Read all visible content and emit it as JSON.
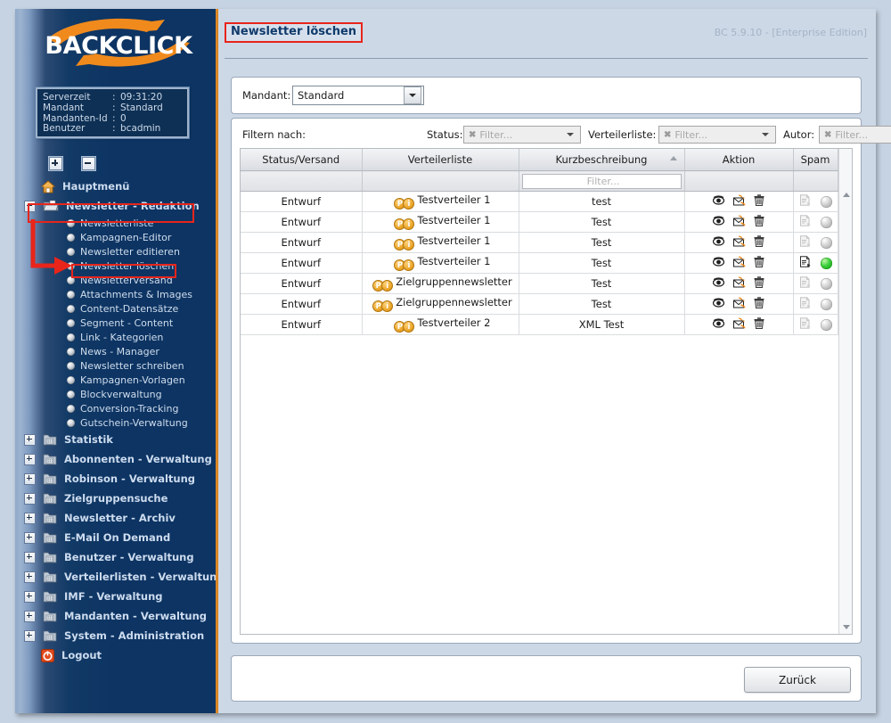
{
  "brand": {
    "logo_text": "BACKCLICK",
    "logo_accent": "#f08a1c"
  },
  "server_info": {
    "rows": [
      {
        "key": "Serverzeit",
        "sep": ":",
        "value": "09:31:20"
      },
      {
        "key": "Mandant",
        "sep": ":",
        "value": "Standard"
      },
      {
        "key": "Mandanten-Id",
        "sep": ":",
        "value": "0"
      },
      {
        "key": "Benutzer",
        "sep": ":",
        "value": "bcadmin"
      }
    ]
  },
  "tree_controls": {
    "expand_all": "expand-all-button",
    "collapse_all": "collapse-all-button"
  },
  "sidebar": {
    "home": {
      "label": "Hauptmenü",
      "icon": "home-icon"
    },
    "sections": [
      {
        "label": "Newsletter - Redaktion",
        "icon": "folder-open-icon",
        "expanded": true,
        "highlighted": true,
        "children": [
          {
            "label": "Newsletterliste"
          },
          {
            "label": "Kampagnen-Editor"
          },
          {
            "label": "Newsletter editieren"
          },
          {
            "label": "Newsletter löschen",
            "highlighted": true
          },
          {
            "label": "Newsletterversand"
          },
          {
            "label": "Attachments & Images"
          },
          {
            "label": "Content-Datensätze"
          },
          {
            "label": "Segment - Content"
          },
          {
            "label": "Link - Kategorien"
          },
          {
            "label": "News - Manager"
          },
          {
            "label": "Newsletter schreiben"
          },
          {
            "label": "Kampagnen-Vorlagen"
          },
          {
            "label": "Blockverwaltung"
          },
          {
            "label": "Conversion-Tracking"
          },
          {
            "label": "Gutschein-Verwaltung"
          }
        ]
      },
      {
        "label": "Statistik",
        "icon": "folder-icon",
        "expanded": false,
        "children": []
      },
      {
        "label": "Abonnenten - Verwaltung",
        "icon": "folder-icon",
        "expanded": false,
        "children": []
      },
      {
        "label": "Robinson - Verwaltung",
        "icon": "folder-icon",
        "expanded": false,
        "children": []
      },
      {
        "label": "Zielgruppensuche",
        "icon": "folder-icon",
        "expanded": false,
        "children": []
      },
      {
        "label": "Newsletter - Archiv",
        "icon": "folder-icon",
        "expanded": false,
        "children": []
      },
      {
        "label": "E-Mail On Demand",
        "icon": "folder-icon",
        "expanded": false,
        "children": []
      },
      {
        "label": "Benutzer - Verwaltung",
        "icon": "folder-icon",
        "expanded": false,
        "children": []
      },
      {
        "label": "Verteilerlisten - Verwaltung",
        "icon": "folder-icon",
        "expanded": false,
        "children": []
      },
      {
        "label": "IMF - Verwaltung",
        "icon": "folder-icon",
        "expanded": false,
        "children": []
      },
      {
        "label": "Mandanten - Verwaltung",
        "icon": "folder-icon",
        "expanded": false,
        "children": []
      },
      {
        "label": "System - Administration",
        "icon": "folder-icon",
        "expanded": false,
        "children": []
      }
    ],
    "logout": {
      "label": "Logout",
      "icon": "power-icon"
    }
  },
  "header": {
    "title": "Newsletter löschen",
    "version": "BC 5.9.10 - [Enterprise Edition]"
  },
  "mandant": {
    "label": "Mandant:",
    "selected": "Standard"
  },
  "filters": {
    "label": "Filtern nach:",
    "fields": [
      {
        "label": "Status:",
        "placeholder": "Filter...",
        "value": ""
      },
      {
        "label": "Verteilerliste:",
        "placeholder": "Filter...",
        "value": ""
      },
      {
        "label": "Autor:",
        "placeholder": "Filter...",
        "value": ""
      }
    ]
  },
  "table": {
    "columns": [
      {
        "label": "Status/Versand",
        "sorted": false
      },
      {
        "label": "Verteilerliste",
        "sorted": false
      },
      {
        "label": "Kurzbeschreibung",
        "sorted": true,
        "sort_dir": "asc"
      },
      {
        "label": "Aktion",
        "sorted": false
      },
      {
        "label": "Spam",
        "sorted": false
      }
    ],
    "column_filter_placeholder": "Filter...",
    "row_badges": [
      "P",
      "i"
    ],
    "action_icons": [
      "preview-eye-icon",
      "send-test-mail-icon",
      "delete-trash-icon"
    ],
    "spam_icons": [
      "spam-report-icon",
      "spam-status-lamp-icon"
    ],
    "rows": [
      {
        "status": "Entwurf",
        "verteilerliste": "Testverteiler 1",
        "kurzbeschreibung": "test",
        "spam_active": false
      },
      {
        "status": "Entwurf",
        "verteilerliste": "Testverteiler 1",
        "kurzbeschreibung": "Test",
        "spam_active": false
      },
      {
        "status": "Entwurf",
        "verteilerliste": "Testverteiler 1",
        "kurzbeschreibung": "Test",
        "spam_active": false
      },
      {
        "status": "Entwurf",
        "verteilerliste": "Testverteiler 1",
        "kurzbeschreibung": "Test",
        "spam_active": true
      },
      {
        "status": "Entwurf",
        "verteilerliste": "Zielgruppennewsletter",
        "kurzbeschreibung": "Test",
        "spam_active": false
      },
      {
        "status": "Entwurf",
        "verteilerliste": "Zielgruppennewsletter",
        "kurzbeschreibung": "Test",
        "spam_active": false
      },
      {
        "status": "Entwurf",
        "verteilerliste": "Testverteiler 2",
        "kurzbeschreibung": "XML Test",
        "spam_active": false
      }
    ]
  },
  "footer": {
    "back_button": "Zurück"
  },
  "colors": {
    "sidebar_bg": "#0d3463",
    "sidebar_accent": "#e08a28",
    "highlight_red": "#e8251b",
    "title_blue": "#103a6b",
    "lamp_green": "#3ccf3c"
  }
}
